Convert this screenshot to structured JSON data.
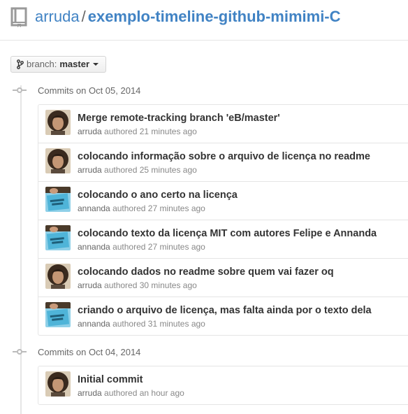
{
  "header": {
    "owner": "arruda",
    "separator": "/",
    "repo": "exemplo-timeline-github-mimimi-C"
  },
  "branch": {
    "prefix": "branch:",
    "name": "master"
  },
  "groups": [
    {
      "label": "Commits on Oct 05, 2014",
      "commits": [
        {
          "message": "Merge remote-tracking branch 'eB/master'",
          "author": "arruda",
          "action": "authored",
          "time": "21 minutes ago",
          "avatar": "arruda-avatar"
        },
        {
          "message": "colocando informação sobre o arquivo de licença no readme",
          "author": "arruda",
          "action": "authored",
          "time": "25 minutes ago",
          "avatar": "arruda-avatar"
        },
        {
          "message": "colocando o ano certo na licença",
          "author": "annanda",
          "action": "authored",
          "time": "27 minutes ago",
          "avatar": "annanda-avatar"
        },
        {
          "message": "colocando texto da licença MIT com autores Felipe e Annanda",
          "author": "annanda",
          "action": "authored",
          "time": "27 minutes ago",
          "avatar": "annanda-avatar"
        },
        {
          "message": "colocando dados no readme sobre quem vai fazer oq",
          "author": "arruda",
          "action": "authored",
          "time": "30 minutes ago",
          "avatar": "arruda-avatar"
        },
        {
          "message": "criando o arquivo de licença, mas falta ainda por o texto dela",
          "author": "annanda",
          "action": "authored",
          "time": "31 minutes ago",
          "avatar": "annanda-avatar"
        }
      ]
    },
    {
      "label": "Commits on Oct 04, 2014",
      "commits": [
        {
          "message": "Initial commit",
          "author": "arruda",
          "action": "authored",
          "time": "an hour ago",
          "avatar": "arruda-avatar"
        }
      ]
    }
  ],
  "colors": {
    "link": "#4183c4",
    "border": "#e5e5e5",
    "muted": "#888888"
  }
}
